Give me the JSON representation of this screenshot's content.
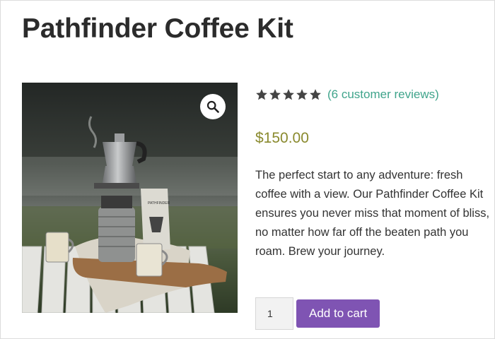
{
  "product": {
    "title": "Pathfinder Coffee Kit",
    "rating_value": 5,
    "rating_max": 5,
    "reviews_link": "(6 customer reviews)",
    "price": "$150.00",
    "description": "The perfect start to any adventure: fresh coffee with a view. Our Pathfinder Coffee Kit ensures you never miss that moment of bliss, no matter how far off the beaten path you roam. Brew your journey.",
    "quantity": "1",
    "add_to_cart_label": "Add to cart",
    "package_label": "PATHFINDER"
  },
  "icons": {
    "zoom": "magnifier-icon",
    "star": "star-icon"
  },
  "colors": {
    "accent_button": "#7f54b3",
    "link": "#3fa48b",
    "price": "#8a8a2e",
    "stars": "#444444"
  }
}
